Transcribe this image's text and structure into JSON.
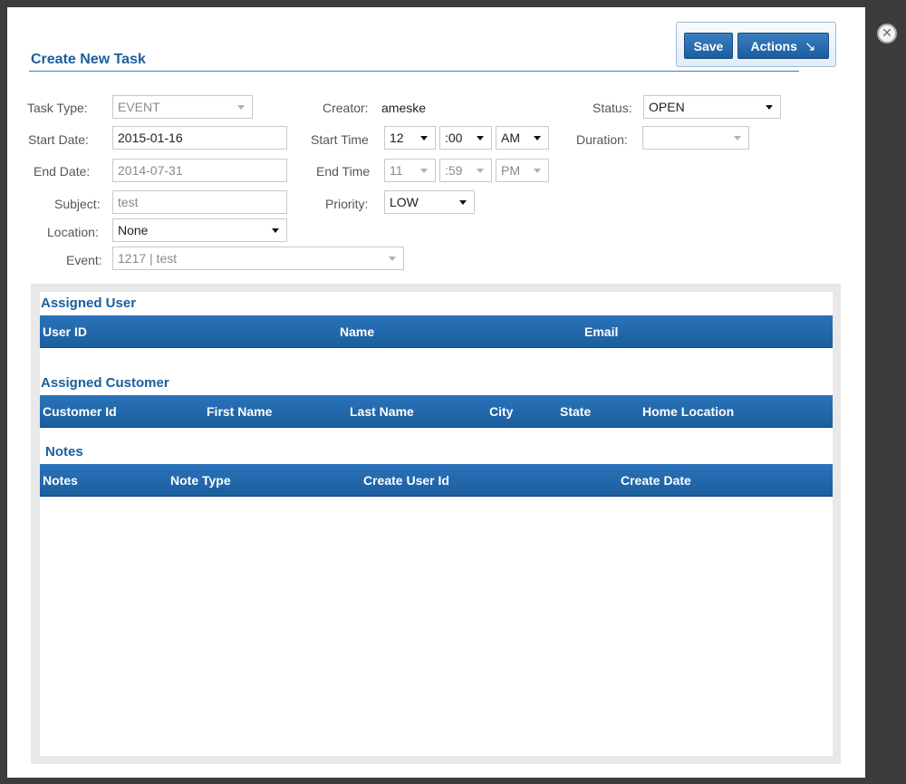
{
  "toolbar": {
    "save_label": "Save",
    "actions_label": "Actions",
    "actions_icon": "↘"
  },
  "close_icon": "✕",
  "form": {
    "title": "Create New Task",
    "task_type": {
      "label": "Task Type:",
      "value": "EVENT"
    },
    "creator": {
      "label": "Creator:",
      "value": "ameske"
    },
    "status": {
      "label": "Status:",
      "value": "OPEN"
    },
    "start_date": {
      "label": "Start Date:",
      "value": "2015-01-16"
    },
    "start_time": {
      "label": "Start Time",
      "hour": "12",
      "minute": ":00",
      "ampm": "AM"
    },
    "duration": {
      "label": "Duration:",
      "value": ""
    },
    "end_date": {
      "label": "End Date:",
      "value": "2014-07-31"
    },
    "end_time": {
      "label": "End Time",
      "hour": "11",
      "minute": ":59",
      "ampm": "PM"
    },
    "subject": {
      "label": "Subject:",
      "value": "test"
    },
    "priority": {
      "label": "Priority:",
      "value": "LOW"
    },
    "location": {
      "label": "Location:",
      "value": "None"
    },
    "event": {
      "label": "Event:",
      "value": "1217 | test"
    }
  },
  "assigned_user": {
    "title": "Assigned User",
    "columns": [
      "User ID",
      "Name",
      "Email"
    ]
  },
  "assigned_customer": {
    "title": "Assigned Customer",
    "columns": [
      "Customer Id",
      "First Name",
      "Last Name",
      "City",
      "State",
      "Home Location"
    ]
  },
  "notes": {
    "title": "Notes",
    "columns": [
      "Notes",
      "Note Type",
      "Create User Id",
      "Create Date"
    ]
  }
}
